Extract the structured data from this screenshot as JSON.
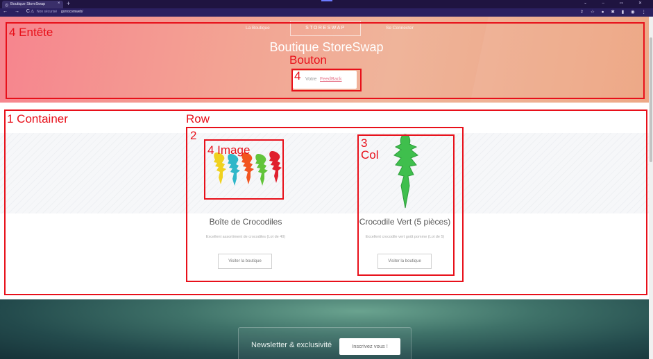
{
  "browser": {
    "tab_title": "Boutique StoreSwap",
    "tab_close": "×",
    "new_tab": "+",
    "nav_buttons": "← → C",
    "security_text": "Non sécurisé",
    "url": "gorrocomweb/",
    "window_controls": "⌄ – ▭ ✕",
    "extensions": "⇪ ☆ ● ✱ ▮ ◉ ⋮"
  },
  "header": {
    "nav_left": "La Boutique",
    "brand": "STORESWAP",
    "nav_right": "Se Connecter",
    "title": "Boutique StoreSwap",
    "feedback_prefix": "Votre",
    "feedback_link": "FeedBack"
  },
  "products": [
    {
      "name": "Boîte de Crocodiles",
      "description": "Excellent assortiment de crocodiles (Lot de 40)",
      "button": "Visiter la boutique"
    },
    {
      "name": "Crocodile Vert (5 pièces)",
      "description": "Excellent crocodile vert goût pomme (Lot de 5)",
      "button": "Visiter la boutique"
    }
  ],
  "annotations": {
    "entete": "4 Entête",
    "bouton": "Bouton",
    "bouton_num": "4",
    "container": "1  Container",
    "row": "Row",
    "col_num": "2",
    "image": "4  Image",
    "col3_num": "3",
    "col3": "Col"
  },
  "newsletter": {
    "text": "Newsletter & exclusivité",
    "button": "Inscrivez vous !"
  },
  "colors": {
    "annotation": "#e8101a",
    "header_gradient_start": "#f6848e",
    "header_gradient_end": "#eca37f",
    "feedback_link": "#e7788c",
    "footer_dark": "#163238"
  }
}
